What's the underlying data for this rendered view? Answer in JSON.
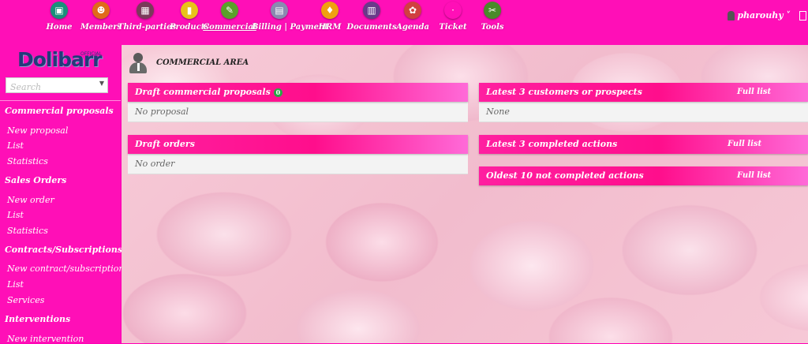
{
  "topmenu": [
    {
      "label": "Home",
      "icon": "home-icon",
      "color": "#1a8f7a",
      "glyph": "▣"
    },
    {
      "label": "Members",
      "icon": "members-icon",
      "color": "#e06b1a",
      "glyph": "☻"
    },
    {
      "label": "Third-parties",
      "icon": "third-parties-icon",
      "color": "#7a3a5a",
      "glyph": "▦"
    },
    {
      "label": "Products",
      "icon": "products-icon",
      "color": "#e8c21a",
      "glyph": "▮"
    },
    {
      "label": "Commercial",
      "icon": "commercial-icon",
      "color": "#5aa02a",
      "glyph": "✎"
    },
    {
      "label": "Billing | Payment",
      "icon": "billing-icon",
      "color": "#8a8ab0",
      "glyph": "▤"
    },
    {
      "label": "HRM",
      "icon": "hrm-icon",
      "color": "#f0a010",
      "glyph": "♦"
    },
    {
      "label": "Documents",
      "icon": "documents-icon",
      "color": "#6a3a8a",
      "glyph": "▥"
    },
    {
      "label": "Agenda",
      "icon": "agenda-icon",
      "color": "#d04040",
      "glyph": "✿"
    },
    {
      "label": "Ticket",
      "icon": "ticket-icon",
      "color": "#ff0fb7",
      "glyph": "·"
    },
    {
      "label": "Tools",
      "icon": "tools-icon",
      "color": "#4a8a2a",
      "glyph": "✂"
    }
  ],
  "user": {
    "name": "pharouhy"
  },
  "logo": {
    "text": "Dolibarr",
    "sub": "OFFICIAL"
  },
  "search": {
    "placeholder": "Search"
  },
  "leftmenu": [
    {
      "label": "Commercial proposals",
      "type": "h"
    },
    {
      "label": "New proposal",
      "type": "s"
    },
    {
      "label": "List",
      "type": "s"
    },
    {
      "label": "Statistics",
      "type": "s"
    },
    {
      "label": "Sales Orders",
      "type": "h"
    },
    {
      "label": "New order",
      "type": "s"
    },
    {
      "label": "List",
      "type": "s"
    },
    {
      "label": "Statistics",
      "type": "s"
    },
    {
      "label": "Contracts/Subscriptions",
      "type": "h"
    },
    {
      "label": "New contract/subscription",
      "type": "s"
    },
    {
      "label": "List",
      "type": "s"
    },
    {
      "label": "Services",
      "type": "s"
    },
    {
      "label": "Interventions",
      "type": "h"
    },
    {
      "label": "New intervention",
      "type": "s"
    }
  ],
  "area": {
    "title": "COMMERCIAL AREA"
  },
  "boxes": {
    "draft_proposals": {
      "title": "Draft commercial proposals",
      "badge": "0",
      "row": "No proposal"
    },
    "draft_orders": {
      "title": "Draft orders",
      "row": "No order"
    },
    "latest_customers": {
      "title": "Latest 3 customers or prospects",
      "link": "Full list",
      "row": "None"
    },
    "completed_actions": {
      "title": "Latest 3 completed actions",
      "link": "Full list"
    },
    "not_completed_actions": {
      "title": "Oldest 10 not completed actions",
      "link": "Full list"
    }
  }
}
